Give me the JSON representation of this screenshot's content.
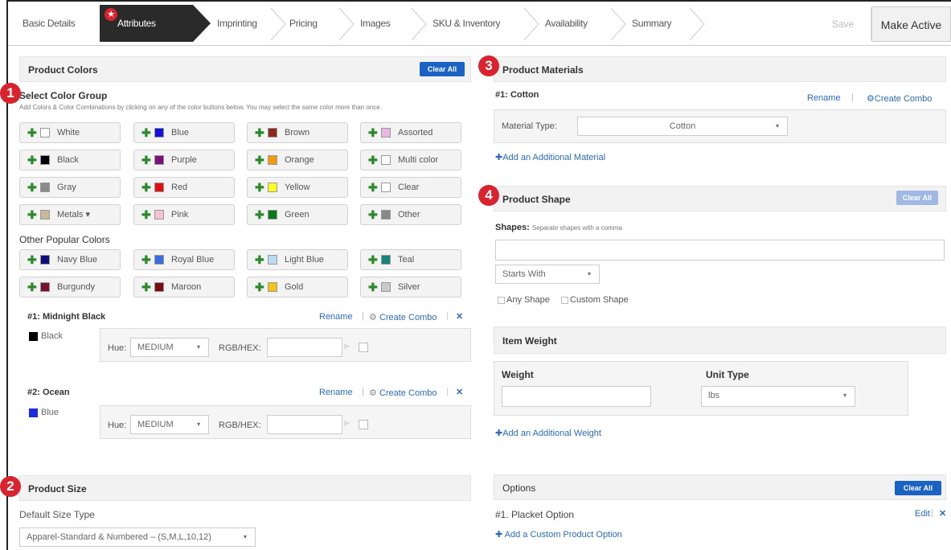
{
  "wizard": {
    "steps": [
      "Basic Details",
      "Attributes",
      "Imprinting",
      "Pricing",
      "Images",
      "SKU & Inventory",
      "Availability",
      "Summary"
    ],
    "save_label": "Save",
    "make_active_label": "Make Active"
  },
  "colors_panel": {
    "badge": "1",
    "title": "Product Colors",
    "clear_label": "Clear All",
    "group_title": "Select Color Group",
    "instructions": "Add Colors & Color Combinations by clicking on any of the color buttons below. You may select the same color more than once.",
    "color_buttons": [
      {
        "label": "White",
        "color": "#ffffff"
      },
      {
        "label": "Blue",
        "color": "#1010d8"
      },
      {
        "label": "Brown",
        "color": "#8b2a1c"
      },
      {
        "label": "Assorted",
        "color": "#e9b8e0"
      },
      {
        "label": "Black",
        "color": "#000000"
      },
      {
        "label": "Purple",
        "color": "#7a127a"
      },
      {
        "label": "Orange",
        "color": "#f39a12"
      },
      {
        "label": "Multi color",
        "color": "#ffffff"
      },
      {
        "label": "Gray",
        "color": "#8a8a8a"
      },
      {
        "label": "Red",
        "color": "#e01010"
      },
      {
        "label": "Yellow",
        "color": "#ffff22"
      },
      {
        "label": "Clear",
        "color": "#ffffff"
      },
      {
        "label": "Metals ▾",
        "color": "#c9b89a"
      },
      {
        "label": "Pink",
        "color": "#f6c3cf"
      },
      {
        "label": "Green",
        "color": "#0a7a1a"
      },
      {
        "label": "Other",
        "color": "#888888"
      }
    ],
    "popular_title": "Other Popular Colors",
    "popular_buttons": [
      {
        "label": "Navy Blue",
        "color": "#0e0e7a"
      },
      {
        "label": "Royal Blue",
        "color": "#3a6ee0"
      },
      {
        "label": "Light Blue",
        "color": "#b8dcf2"
      },
      {
        "label": "Teal",
        "color": "#16847a"
      },
      {
        "label": "Burgundy",
        "color": "#7a1030"
      },
      {
        "label": "Maroon",
        "color": "#7a0e0e"
      },
      {
        "label": "Gold",
        "color": "#f2c418"
      },
      {
        "label": "Silver",
        "color": "#c9c9c9"
      }
    ],
    "combos": [
      {
        "title": "#1: Midnight Black",
        "swatch_label": "Black",
        "swatch_color": "#000000",
        "hue_label": "Hue:",
        "hue_value": "MEDIUM",
        "rgb_label": "RGB/HEX:",
        "rename": "Rename",
        "create_combo": "Create Combo"
      },
      {
        "title": "#2: Ocean",
        "swatch_label": "Blue",
        "swatch_color": "#1a2be0",
        "hue_label": "Hue:",
        "hue_value": "MEDIUM",
        "rgb_label": "RGB/HEX:",
        "rename": "Rename",
        "create_combo": "Create Combo"
      }
    ]
  },
  "size_panel": {
    "badge": "2",
    "title": "Product Size",
    "default_label": "Default Size Type",
    "default_value": "Apparel-Standard & Numbered – (S,M,L,10,12)"
  },
  "materials_panel": {
    "badge": "3",
    "title": "Product Materials",
    "item_title": "#1:  Cotton",
    "rename": "Rename",
    "create_combo": "Create Combo",
    "material_type_label": "Material Type:",
    "material_type_value": "Cotton",
    "add_link": "Add an Additional Material"
  },
  "shape_panel": {
    "badge": "4",
    "title": "Product Shape",
    "clear_label": "Clear All",
    "shapes_label": "Shapes:",
    "shapes_hint": "Separate shapes with a comma",
    "shapes_value": "",
    "filter_value": "Starts With",
    "any_shape": "Any Shape",
    "custom_shape": "Custom Shape"
  },
  "weight_panel": {
    "title": "Item Weight",
    "weight_label": "Weight",
    "weight_value": "",
    "unit_label": "Unit Type",
    "unit_value": "lbs",
    "add_link": "Add an Additional Weight"
  },
  "options_panel": {
    "title": "Options",
    "clear_label": "Clear All",
    "item_label": "#1.  Placket Option",
    "edit_label": "Edit",
    "add_link": "Add a Custom Product Option"
  }
}
